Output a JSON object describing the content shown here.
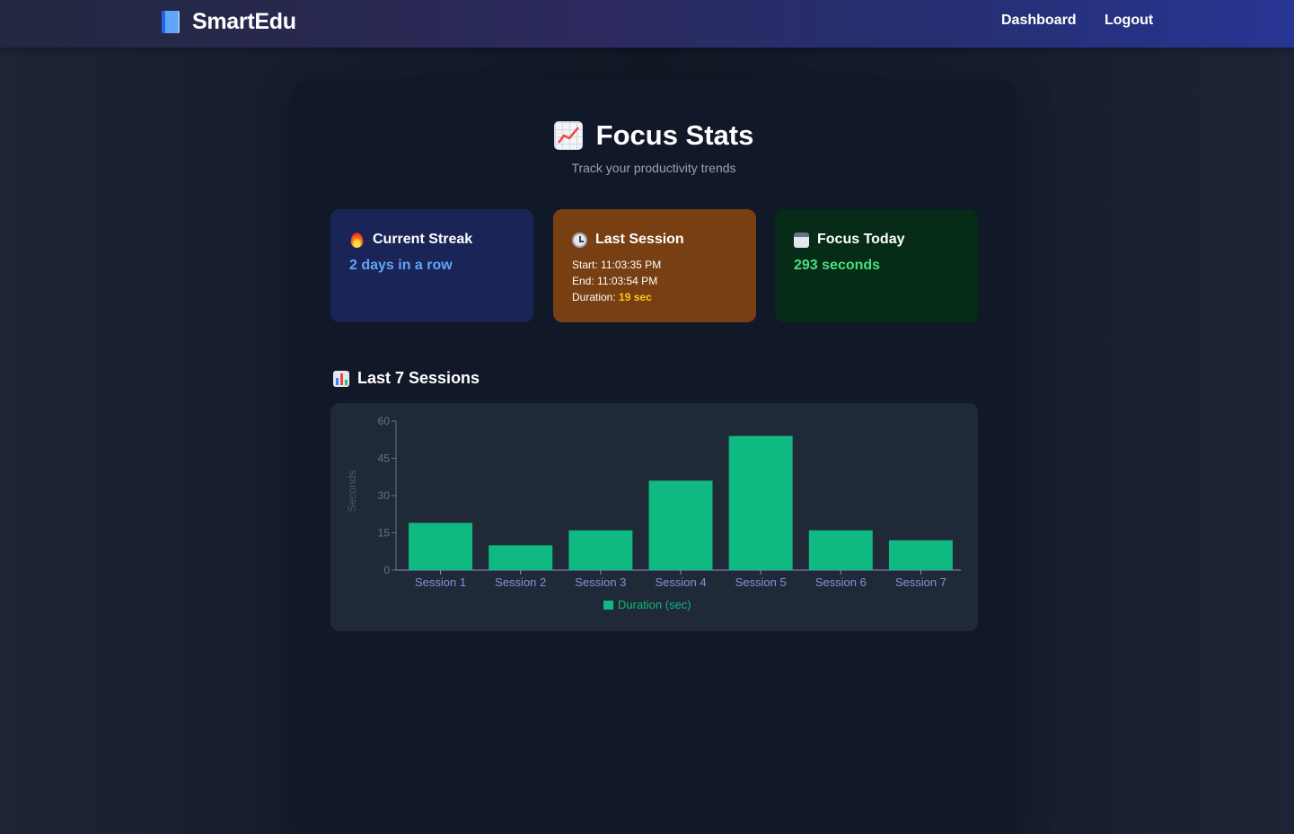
{
  "nav": {
    "brand": "SmartEdu",
    "brand_icon": "book-icon",
    "links": [
      "Dashboard",
      "Logout"
    ]
  },
  "page": {
    "title": "Focus Stats",
    "title_icon": "chart-increasing-icon",
    "subtitle": "Track your productivity trends"
  },
  "cards": {
    "streak": {
      "icon": "fire-icon",
      "title": "Current Streak",
      "value": "2 days in a row",
      "color": "#60a5fa"
    },
    "last_session": {
      "icon": "clock-icon",
      "title": "Last Session",
      "start_label": "Start:",
      "start": "11:03:35 PM",
      "end_label": "End:",
      "end": "11:03:54 PM",
      "duration_label": "Duration:",
      "duration": "19 sec",
      "duration_color": "#facc15"
    },
    "today": {
      "icon": "calendar-icon",
      "title": "Focus Today",
      "value": "293 seconds",
      "color": "#4ade80"
    }
  },
  "section": {
    "icon": "bar-chart-icon",
    "title": "Last 7 Sessions"
  },
  "colors": {
    "bar": "#10b981",
    "axis": "#8b8fd9",
    "panel": "#111827"
  },
  "chart_data": {
    "type": "bar",
    "categories": [
      "Session 1",
      "Session 2",
      "Session 3",
      "Session 4",
      "Session 5",
      "Session 6",
      "Session 7"
    ],
    "series": [
      {
        "name": "Duration (sec)",
        "values": [
          19,
          10,
          16,
          36,
          54,
          16,
          12
        ]
      }
    ],
    "ylabel": "Seconds",
    "xlabel": "",
    "ylim": [
      0,
      60
    ],
    "yticks": [
      0,
      15,
      30,
      45,
      60
    ],
    "grid": false,
    "legend": "bottom-center"
  }
}
